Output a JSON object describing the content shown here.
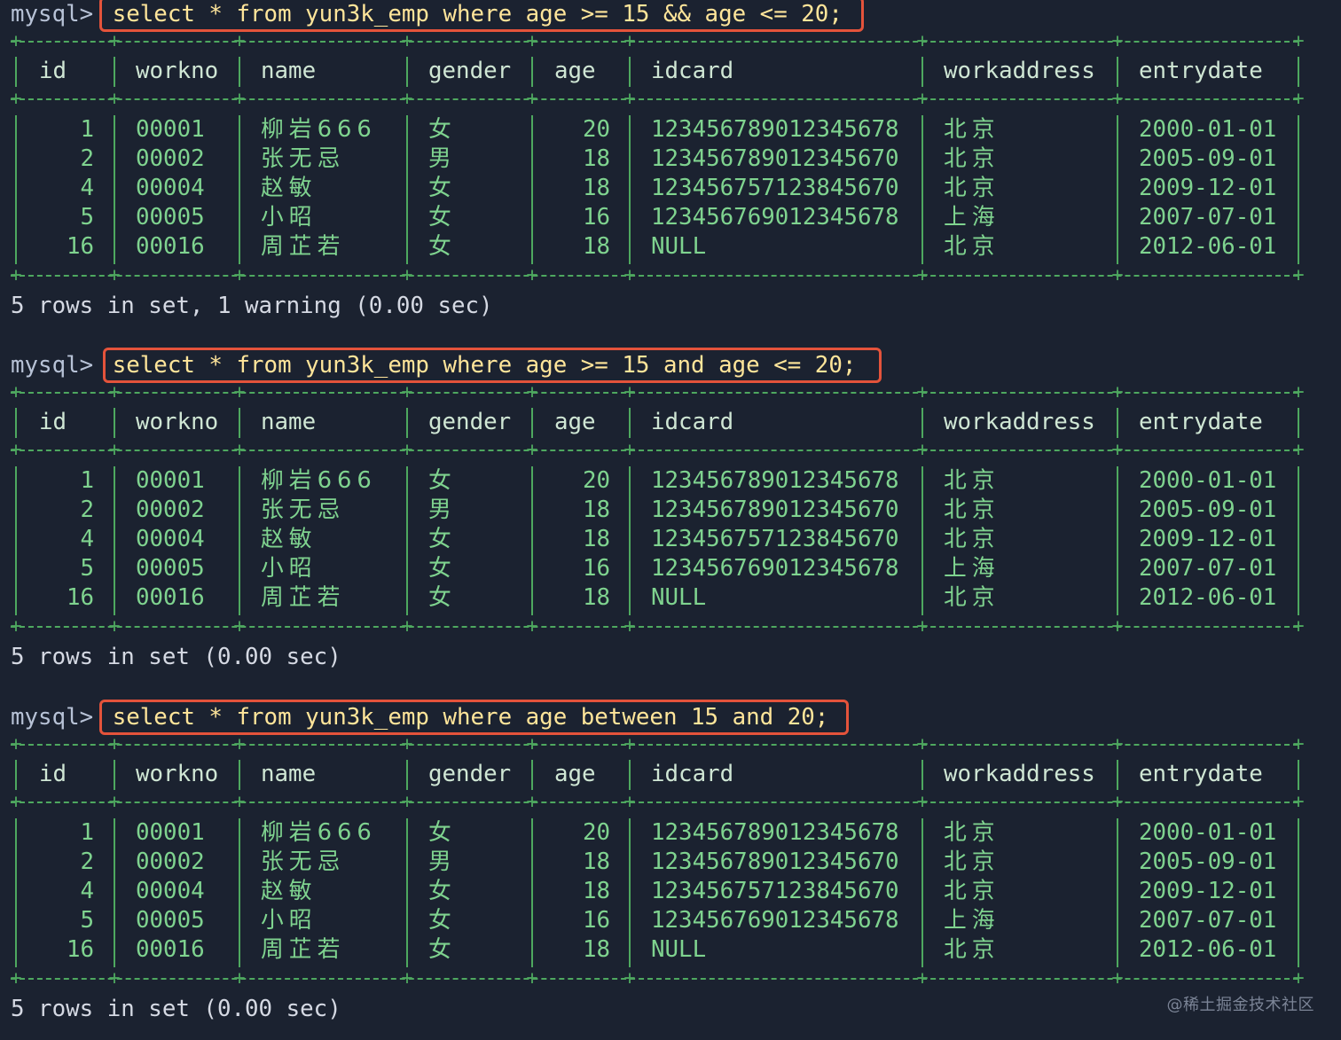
{
  "prompt": "mysql>",
  "columns": [
    "id",
    "workno",
    "name",
    "gender",
    "age",
    "idcard",
    "workaddress",
    "entrydate"
  ],
  "queries": [
    {
      "command": "select * from yun3k_emp where age >= 15 && age <= 20;",
      "rows": [
        [
          "1",
          "00001",
          "柳岩666",
          "女",
          "20",
          "123456789012345678",
          "北京",
          "2000-01-01"
        ],
        [
          "2",
          "00002",
          "张无忌",
          "男",
          "18",
          "123456789012345670",
          "北京",
          "2005-09-01"
        ],
        [
          "4",
          "00004",
          "赵敏",
          "女",
          "18",
          "123456757123845670",
          "北京",
          "2009-12-01"
        ],
        [
          "5",
          "00005",
          "小昭",
          "女",
          "16",
          "123456769012345678",
          "上海",
          "2007-07-01"
        ],
        [
          "16",
          "00016",
          "周芷若",
          "女",
          "18",
          "NULL",
          "北京",
          "2012-06-01"
        ]
      ],
      "result": "5 rows in set, 1 warning (0.00 sec)"
    },
    {
      "command": "select * from yun3k_emp where age >= 15 and age <= 20;",
      "rows": [
        [
          "1",
          "00001",
          "柳岩666",
          "女",
          "20",
          "123456789012345678",
          "北京",
          "2000-01-01"
        ],
        [
          "2",
          "00002",
          "张无忌",
          "男",
          "18",
          "123456789012345670",
          "北京",
          "2005-09-01"
        ],
        [
          "4",
          "00004",
          "赵敏",
          "女",
          "18",
          "123456757123845670",
          "北京",
          "2009-12-01"
        ],
        [
          "5",
          "00005",
          "小昭",
          "女",
          "16",
          "123456769012345678",
          "上海",
          "2007-07-01"
        ],
        [
          "16",
          "00016",
          "周芷若",
          "女",
          "18",
          "NULL",
          "北京",
          "2012-06-01"
        ]
      ],
      "result": "5 rows in set (0.00 sec)"
    },
    {
      "command": "select * from yun3k_emp where age between 15 and 20;",
      "rows": [
        [
          "1",
          "00001",
          "柳岩666",
          "女",
          "20",
          "123456789012345678",
          "北京",
          "2000-01-01"
        ],
        [
          "2",
          "00002",
          "张无忌",
          "男",
          "18",
          "123456789012345670",
          "北京",
          "2005-09-01"
        ],
        [
          "4",
          "00004",
          "赵敏",
          "女",
          "18",
          "123456757123845670",
          "北京",
          "2009-12-01"
        ],
        [
          "5",
          "00005",
          "小昭",
          "女",
          "16",
          "123456769012345678",
          "上海",
          "2007-07-01"
        ],
        [
          "16",
          "00016",
          "周芷若",
          "女",
          "18",
          "NULL",
          "北京",
          "2012-06-01"
        ]
      ],
      "result": "5 rows in set (0.00 sec)"
    }
  ],
  "watermark": "@稀土掘金技术社区",
  "colors": {
    "background": "#1b2230",
    "table_text": "#7fd38f",
    "table_border": "#4ea85f",
    "command_text": "#ffe59a",
    "highlight_box": "#e4533b"
  }
}
